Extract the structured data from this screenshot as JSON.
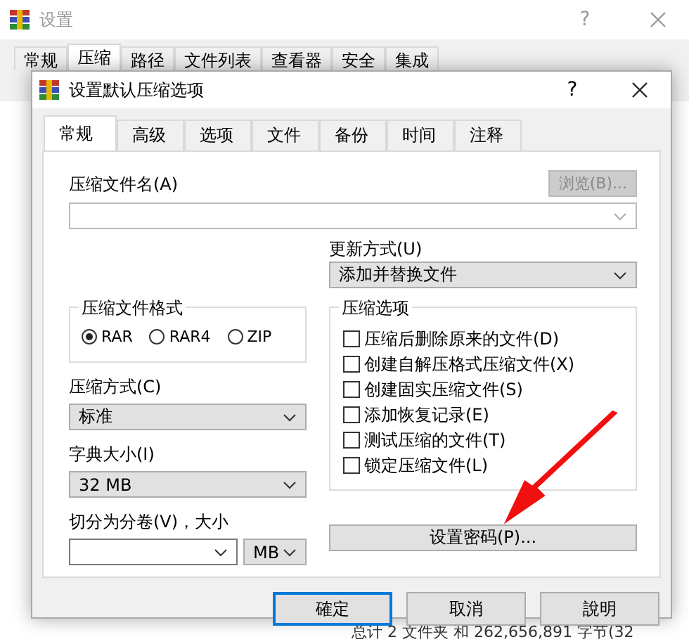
{
  "window": {
    "title": "设置",
    "help": "?"
  },
  "outer_tabs": [
    {
      "label": "常规",
      "selected": false
    },
    {
      "label": "压缩",
      "selected": true
    },
    {
      "label": "路径",
      "selected": false
    },
    {
      "label": "文件列表",
      "selected": false
    },
    {
      "label": "查看器",
      "selected": false
    },
    {
      "label": "安全",
      "selected": false
    },
    {
      "label": "集成",
      "selected": false
    }
  ],
  "status_bar": "总计 2 文件夹 和 262,656,891 字节(32",
  "dialog": {
    "title": "设置默认压缩选项",
    "help": "?",
    "tabs": [
      {
        "label": "常规",
        "selected": true
      },
      {
        "label": "高级",
        "selected": false
      },
      {
        "label": "选项",
        "selected": false
      },
      {
        "label": "文件",
        "selected": false
      },
      {
        "label": "备份",
        "selected": false
      },
      {
        "label": "时间",
        "selected": false
      },
      {
        "label": "注释",
        "selected": false
      }
    ],
    "archive_name": {
      "label": "压缩文件名(A)"
    },
    "browse_button": {
      "label": "浏览(B)...",
      "disabled": true
    },
    "update_mode": {
      "label": "更新方式(U)",
      "value": "添加并替换文件"
    },
    "format_group": {
      "title": "压缩文件格式",
      "options": [
        {
          "label": "RAR",
          "selected": true
        },
        {
          "label": "RAR4",
          "selected": false
        },
        {
          "label": "ZIP",
          "selected": false
        }
      ]
    },
    "options_group": {
      "title": "压缩选项",
      "items": [
        {
          "label": "压缩后删除原来的文件(D)",
          "checked": false
        },
        {
          "label": "创建自解压格式压缩文件(X)",
          "checked": false
        },
        {
          "label": "创建固实压缩文件(S)",
          "checked": false
        },
        {
          "label": "添加恢复记录(E)",
          "checked": false
        },
        {
          "label": "测试压缩的文件(T)",
          "checked": false
        },
        {
          "label": "锁定压缩文件(L)",
          "checked": false
        }
      ]
    },
    "compression_method": {
      "label": "压缩方式(C)",
      "value": "标准"
    },
    "dictionary_size": {
      "label": "字典大小(I)",
      "value": "32 MB"
    },
    "split": {
      "label": "切分为分卷(V)，大小",
      "unit": "MB"
    },
    "password_button": {
      "label": "设置密码(P)..."
    },
    "buttons": [
      {
        "label": "確定",
        "default": true
      },
      {
        "label": "取消",
        "default": false
      },
      {
        "label": "說明",
        "default": false
      }
    ]
  }
}
